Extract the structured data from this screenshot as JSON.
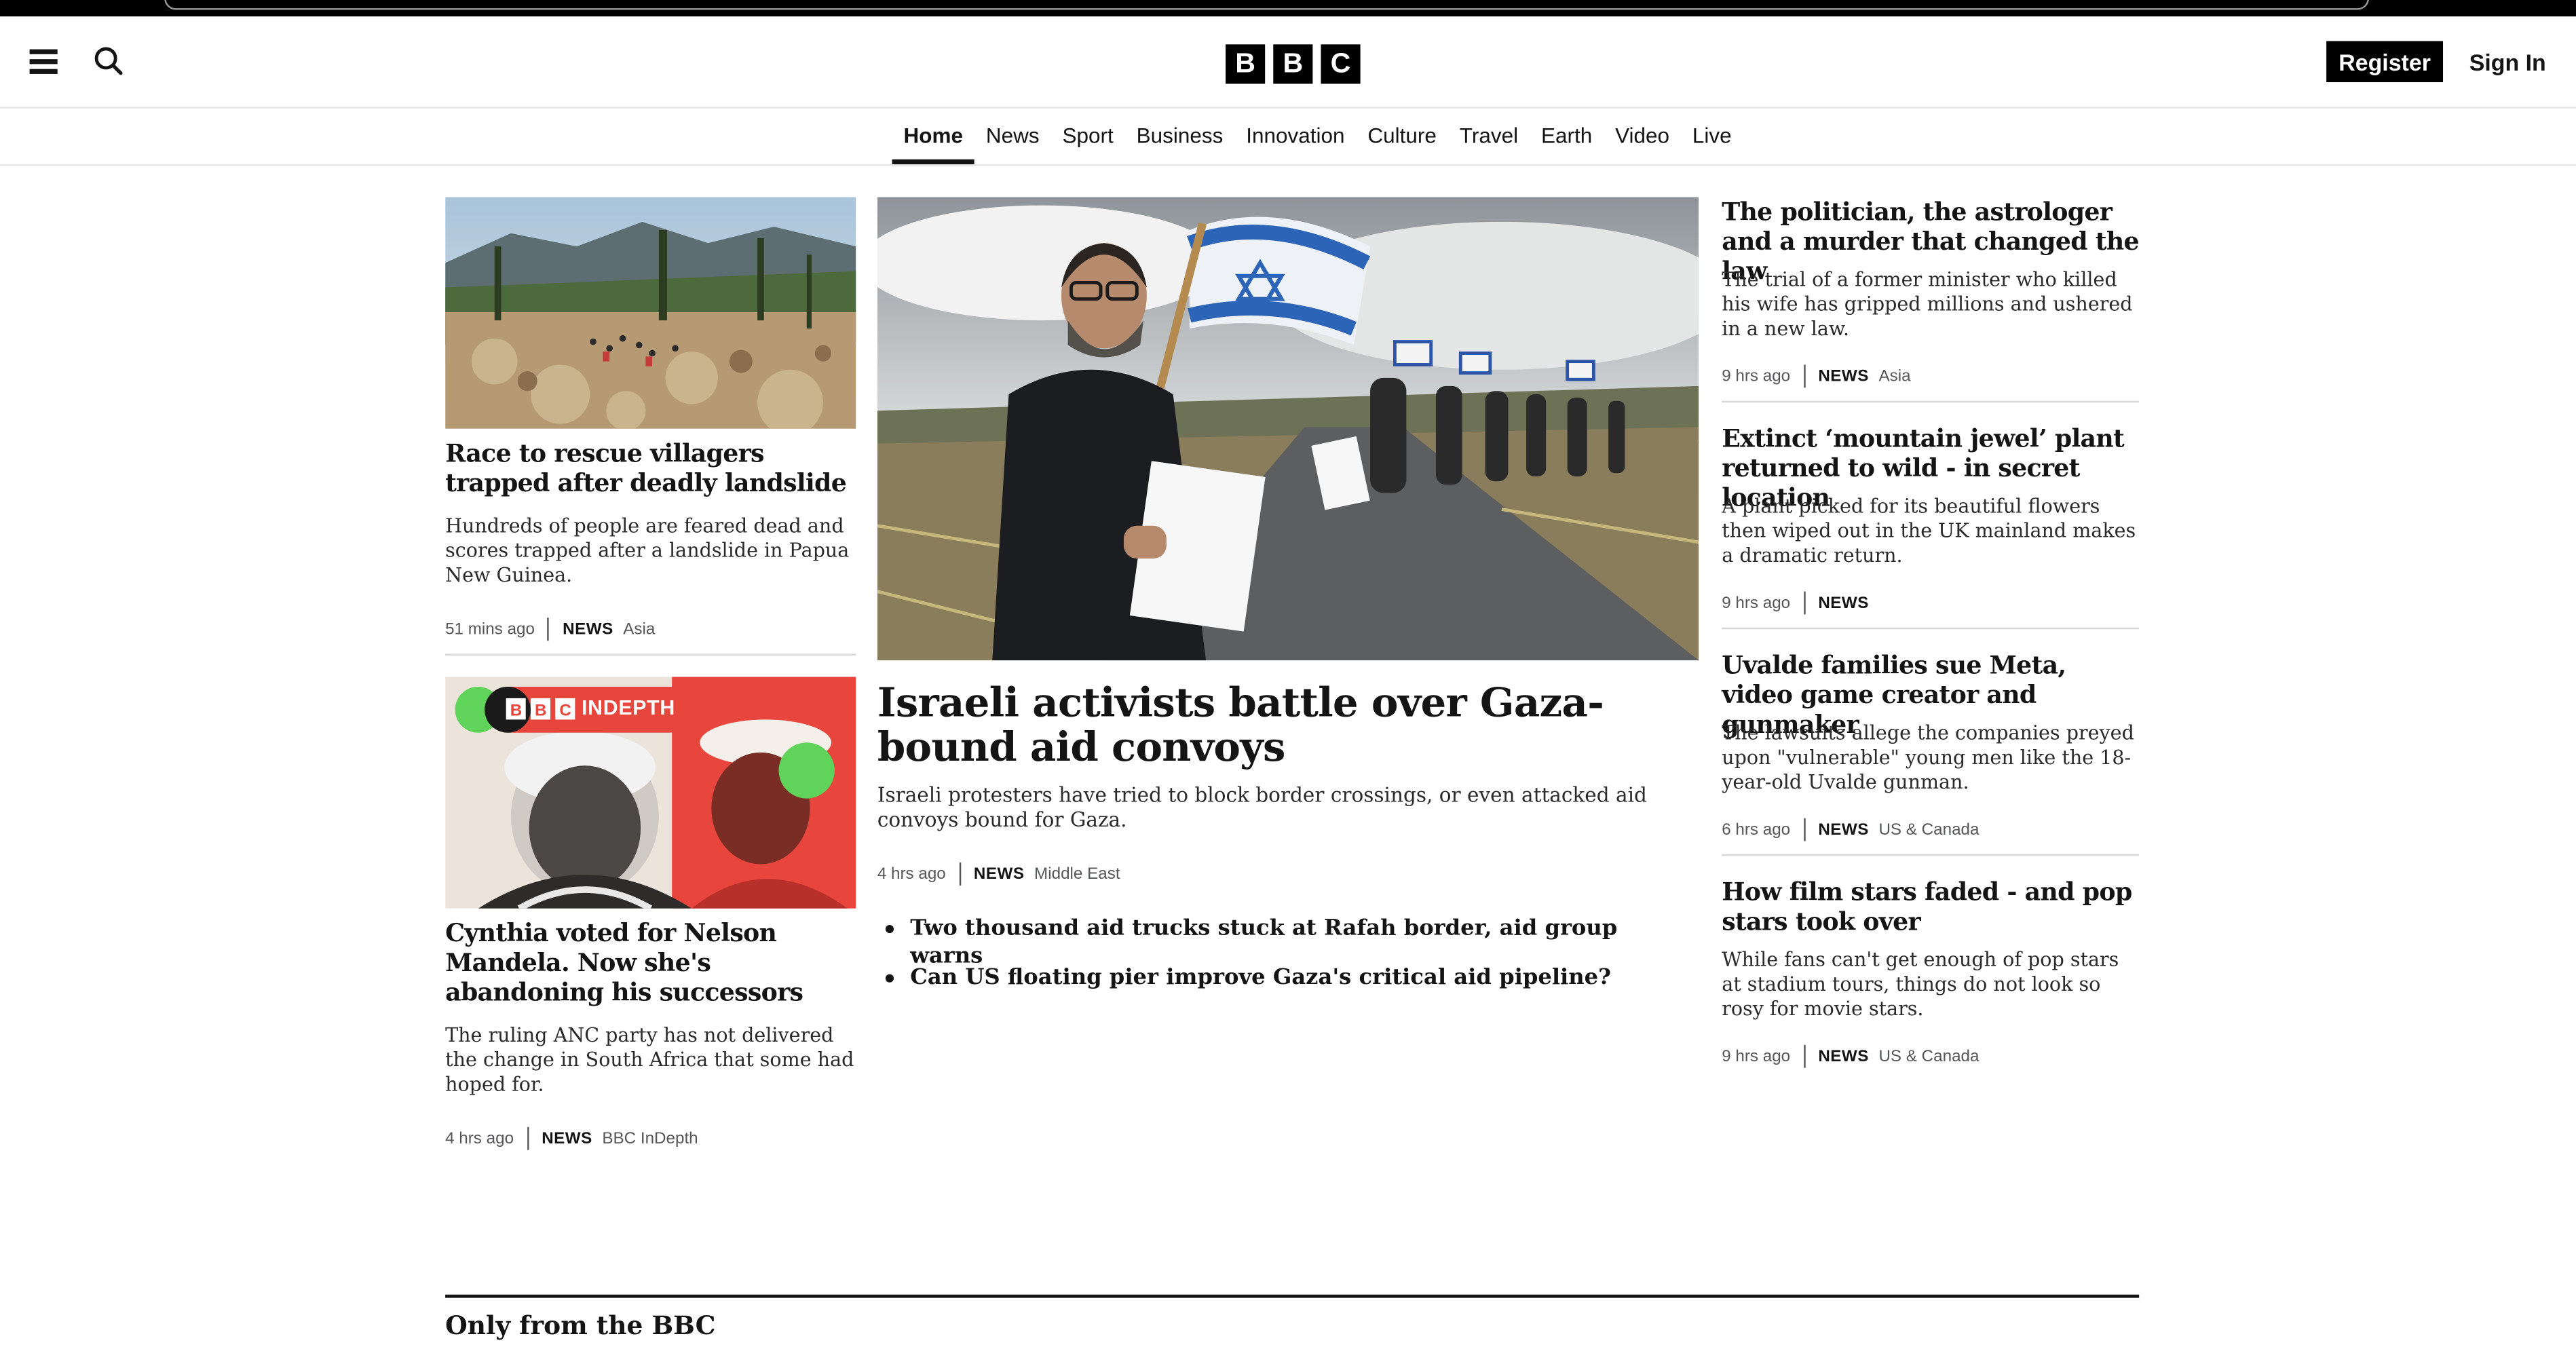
{
  "header": {
    "logo_letters": [
      "B",
      "B",
      "C"
    ],
    "register_label": "Register",
    "signin_label": "Sign In"
  },
  "nav": {
    "items": [
      "Home",
      "News",
      "Sport",
      "Business",
      "Innovation",
      "Culture",
      "Travel",
      "Earth",
      "Video",
      "Live"
    ],
    "active": "Home"
  },
  "left_column": [
    {
      "headline": "Race to rescue villagers trapped after deadly landslide",
      "summary": "Hundreds of people are feared dead and scores trapped after a landslide in Papua New Guinea.",
      "time": "51 mins ago",
      "tag": "NEWS",
      "region": "Asia"
    },
    {
      "badge": "INDEPTH",
      "headline": "Cynthia voted for Nelson Mandela. Now she's abandoning his successors",
      "summary": "The ruling ANC party has not delivered the change in South Africa that some had hoped for.",
      "time": "4 hrs ago",
      "tag": "NEWS",
      "region": "BBC InDepth"
    }
  ],
  "main_story": {
    "headline": "Israeli activists battle over Gaza-bound aid convoys",
    "summary": "Israeli protesters have tried to block border crossings, or even attacked aid convoys bound for Gaza.",
    "time": "4 hrs ago",
    "tag": "NEWS",
    "region": "Middle East",
    "related": [
      "Two thousand aid trucks stuck at Rafah border, aid group warns",
      "Can US floating pier improve Gaza's critical aid pipeline?"
    ]
  },
  "right_column": [
    {
      "headline": "The politician, the astrologer and a murder that changed the law",
      "summary": "The trial of a former minister who killed his wife has gripped millions and ushered in a new law.",
      "time": "9 hrs ago",
      "tag": "NEWS",
      "region": "Asia"
    },
    {
      "headline": "Extinct ‘mountain jewel’ plant returned to wild - in secret location",
      "summary": "A plant picked for its beautiful flowers then wiped out in the UK mainland makes a dramatic return.",
      "time": "9 hrs ago",
      "tag": "NEWS",
      "region": ""
    },
    {
      "headline": "Uvalde families sue Meta, video game creator and gunmaker",
      "summary": "The lawsuits allege the companies preyed upon \"vulnerable\" young men like the 18-year-old Uvalde gunman.",
      "time": "6 hrs ago",
      "tag": "NEWS",
      "region": "US & Canada"
    },
    {
      "headline": "How film stars faded - and pop stars took over",
      "summary": "While fans can't get enough of pop stars at stadium tours, things do not look so rosy for movie stars.",
      "time": "9 hrs ago",
      "tag": "NEWS",
      "region": "US & Canada"
    }
  ],
  "section": {
    "title": "Only from the BBC"
  },
  "colors": {
    "text": "#141414",
    "accent_red": "#e8453c",
    "accent_green": "#5fd35a",
    "black": "#000000"
  }
}
